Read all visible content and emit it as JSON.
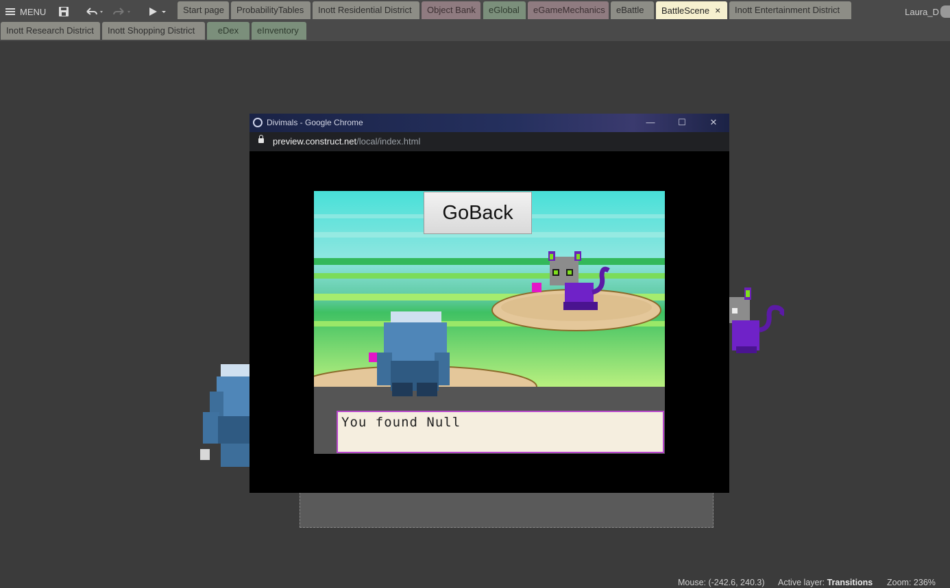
{
  "toolbar": {
    "menu_label": "MENU",
    "icons": [
      "menu-icon",
      "save-icon",
      "undo-icon",
      "redo-icon",
      "play-icon"
    ]
  },
  "tabs_row1": [
    {
      "label": "Start page",
      "color": "default"
    },
    {
      "label": "ProbabilityTables",
      "color": "default"
    },
    {
      "label": "Inott Residential District",
      "color": "default"
    },
    {
      "label": "Object Bank",
      "color": "red"
    },
    {
      "label": "eGlobal",
      "color": "green"
    },
    {
      "label": "eGameMechanics",
      "color": "red"
    },
    {
      "label": "eBattle",
      "color": "default"
    },
    {
      "label": "BattleScene",
      "color": "active",
      "close": "×"
    },
    {
      "label": "Inott Entertainment District",
      "color": "default"
    }
  ],
  "tabs_row2": [
    {
      "label": "Inott Research District",
      "color": "default"
    },
    {
      "label": "Inott Shopping District",
      "color": "default"
    },
    {
      "label": "eDex",
      "color": "green"
    },
    {
      "label": "eInventory",
      "color": "green"
    }
  ],
  "user": {
    "name": "Laura_D"
  },
  "preview_window": {
    "title": "Divimals - Google Chrome",
    "url_host": "preview.construct.net",
    "url_path": "/local/index.html",
    "minimize": "—",
    "maximize": "☐",
    "close": "✕"
  },
  "game": {
    "goback_label": "GoBack",
    "message": "You found Null"
  },
  "statusbar": {
    "mouse_label": "Mouse:",
    "mouse_value": "(-242.6, 240.3)",
    "layer_label": "Active layer:",
    "layer_value": "Transitions",
    "zoom_label": "Zoom:",
    "zoom_value": "236%"
  },
  "colors": {
    "workspace": "#3b3b3b",
    "active_tab": "#f6f0cf",
    "message_border": "#b545c9",
    "message_bg": "#f5eedf"
  }
}
